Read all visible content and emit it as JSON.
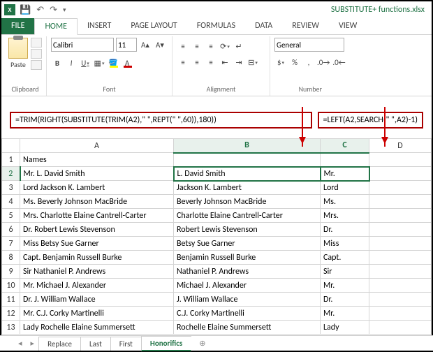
{
  "title_bar": {
    "filename": "SUBSTITUTE+ functions.xlsx"
  },
  "ribbon": {
    "tabs": [
      "FILE",
      "HOME",
      "INSERT",
      "PAGE LAYOUT",
      "FORMULAS",
      "DATA",
      "REVIEW",
      "VIEW"
    ],
    "active_tab": "HOME",
    "clipboard": {
      "paste": "Paste",
      "label": "Clipboard"
    },
    "font": {
      "name": "Calibri",
      "size": "11",
      "label": "Font"
    },
    "alignment": {
      "label": "Alignment"
    },
    "number": {
      "format": "General",
      "label": "Number"
    }
  },
  "formulas": {
    "b2": "=TRIM(RIGHT(SUBSTITUTE(TRIM(A2),\" \",REPT(\" \",60)),180))",
    "c2": "=LEFT(A2,SEARCH(\" \",A2)-1)"
  },
  "columns": [
    "",
    "A",
    "B",
    "C",
    "D"
  ],
  "header_row": {
    "a": "Names"
  },
  "rows": [
    {
      "n": "1",
      "a": "Names",
      "b": "",
      "c": ""
    },
    {
      "n": "2",
      "a": "Mr. L. David Smith",
      "b": "L. David Smith",
      "c": "Mr."
    },
    {
      "n": "3",
      "a": "Lord Jackson K. Lambert",
      "b": "Jackson K. Lambert",
      "c": "Lord"
    },
    {
      "n": "4",
      "a": "Ms. Beverly Johnson MacBride",
      "b": "Beverly Johnson MacBride",
      "c": "Ms."
    },
    {
      "n": "5",
      "a": "Mrs. Charlotte Elaine Cantrell-Carter",
      "b": "Charlotte Elaine Cantrell-Carter",
      "c": "Mrs."
    },
    {
      "n": "6",
      "a": "Dr. Robert Lewis Stevenson",
      "b": "Robert Lewis Stevenson",
      "c": "Dr."
    },
    {
      "n": "7",
      "a": "Miss Betsy Sue Garner",
      "b": "Betsy Sue Garner",
      "c": "Miss"
    },
    {
      "n": "8",
      "a": "Capt. Benjamin Russell Burke",
      "b": "Benjamin Russell Burke",
      "c": "Capt."
    },
    {
      "n": "9",
      "a": "Sir Nathaniel P. Andrews",
      "b": "Nathaniel P. Andrews",
      "c": "Sir"
    },
    {
      "n": "10",
      "a": "Mr. Michael J. Alexander",
      "b": "Michael J. Alexander",
      "c": "Mr."
    },
    {
      "n": "11",
      "a": "Dr. J. William Wallace",
      "b": "J. William Wallace",
      "c": "Dr."
    },
    {
      "n": "12",
      "a": "Mr. C.J. Corky Martinelli",
      "b": "C.J. Corky Martinelli",
      "c": "Mr."
    },
    {
      "n": "13",
      "a": "Lady Rochelle Elaine Summersett",
      "b": "Rochelle Elaine Summersett",
      "c": "Lady"
    }
  ],
  "sheets": {
    "list": [
      "Replace",
      "Last",
      "First",
      "Honorifics"
    ],
    "active": "Honorifics",
    "add": "⊕"
  }
}
